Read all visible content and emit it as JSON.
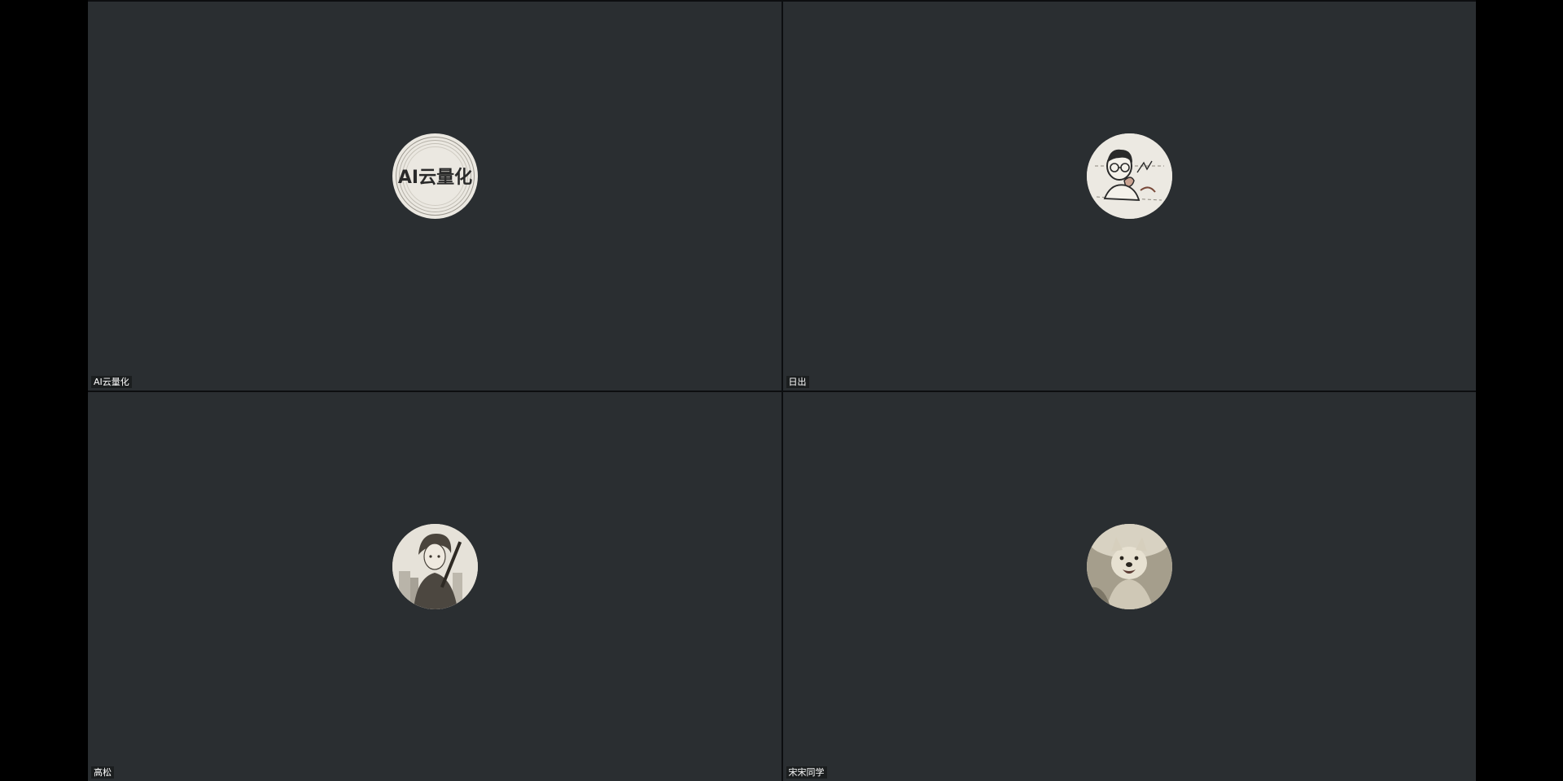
{
  "participants": [
    {
      "name": "AI云量化",
      "avatar_icon": "ai-cloud-quant-logo-avatar",
      "avatar_text": "AI云量化"
    },
    {
      "name": "日出",
      "avatar_icon": "cartoon-man-avatar"
    },
    {
      "name": "高松",
      "avatar_icon": "anime-character-avatar"
    },
    {
      "name": "宋宋同学",
      "avatar_icon": "dog-photo-avatar"
    }
  ],
  "colors": {
    "tile_background": "#2a2e31",
    "page_background": "#000000",
    "avatar_background": "#e9e6df",
    "label_text": "#ffffff"
  }
}
